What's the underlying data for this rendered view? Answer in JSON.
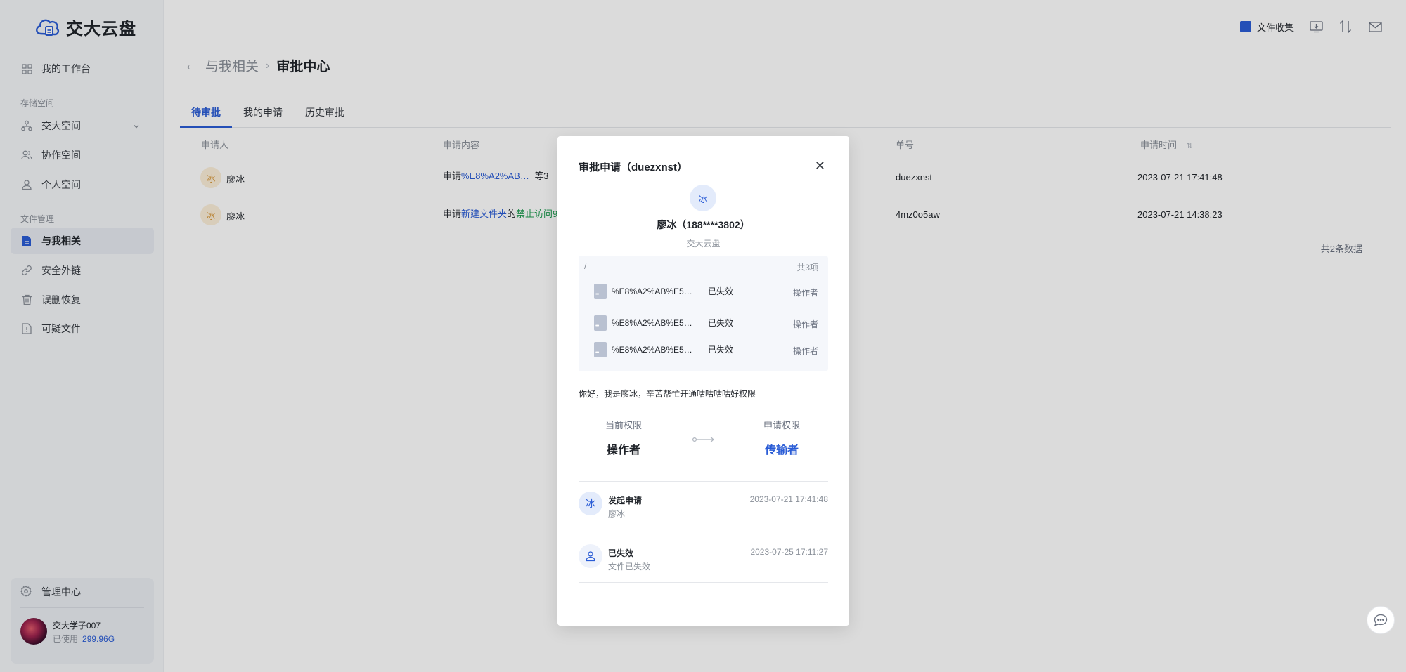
{
  "app": {
    "title": "交大云盘"
  },
  "sidebar": {
    "workbench": "我的工作台",
    "storage_label": "存储空间",
    "storage_items": [
      {
        "label": "交大空间",
        "icon": "org-tree-icon"
      },
      {
        "label": "协作空间",
        "icon": "users-icon"
      },
      {
        "label": "个人空间",
        "icon": "user-icon"
      }
    ],
    "file_label": "文件管理",
    "file_items": [
      {
        "label": "与我相关",
        "icon": "file-icon",
        "active": true
      },
      {
        "label": "安全外链",
        "icon": "link-icon"
      },
      {
        "label": "误删恢复",
        "icon": "trash-icon"
      },
      {
        "label": "可疑文件",
        "icon": "alert-file-icon"
      }
    ],
    "admin": "管理中心",
    "user": {
      "name": "交大学子007",
      "usage_label": "已使用",
      "usage_value": "299.96G"
    }
  },
  "topbar": {
    "collect_label": "文件收集"
  },
  "breadcrumb": {
    "parent": "与我相关",
    "current": "审批中心"
  },
  "tabs": [
    "待审批",
    "我的申请",
    "历史审批"
  ],
  "table": {
    "headers": {
      "applicant": "申请人",
      "content": "申请内容",
      "order": "单号",
      "time": "申请时间"
    },
    "rows": [
      {
        "avatar": "冰",
        "name": "廖冰",
        "content_prefix": "申请",
        "content_link": "%E8%A2%AB…",
        "content_suffix": "等3",
        "order": "duezxnst",
        "time": "2023-07-21 17:41:48"
      },
      {
        "avatar": "冰",
        "name": "廖冰",
        "content_prefix": "申请",
        "content_link": "新建文件夹",
        "content_mid": "的",
        "content_green": "禁止访问9",
        "order": "4mz0o5aw",
        "time": "2023-07-21 14:38:23"
      }
    ],
    "total": "共2条数据"
  },
  "modal": {
    "title": "审批申请（duezxnst）",
    "avatar": "冰",
    "user": "廖冰（188****3802）",
    "org": "交大云盘",
    "path": "/",
    "count": "共3项",
    "files": [
      {
        "name": "%E8%A2%AB%E5…",
        "status": "已失效",
        "role": "操作者"
      },
      {
        "name": "%E8%A2%AB%E5…",
        "status": "已失效",
        "role": "操作者"
      },
      {
        "name": "%E8%A2%AB%E5…",
        "status": "已失效",
        "role": "操作者"
      }
    ],
    "message": "你好，我是廖冰，辛苦帮忙开通咕咕咕咕好权限",
    "current_perm_label": "当前权限",
    "current_perm": "操作者",
    "request_perm_label": "申请权限",
    "request_perm": "传输者",
    "timeline": [
      {
        "avatar": "冰",
        "title": "发起申请",
        "sub": "廖冰",
        "time": "2023-07-21 17:41:48"
      },
      {
        "title": "已失效",
        "sub": "文件已失效",
        "time": "2023-07-25 17:11:27"
      }
    ]
  },
  "colors": {
    "accent": "#2a5cd6",
    "green": "#1d9a4e"
  }
}
